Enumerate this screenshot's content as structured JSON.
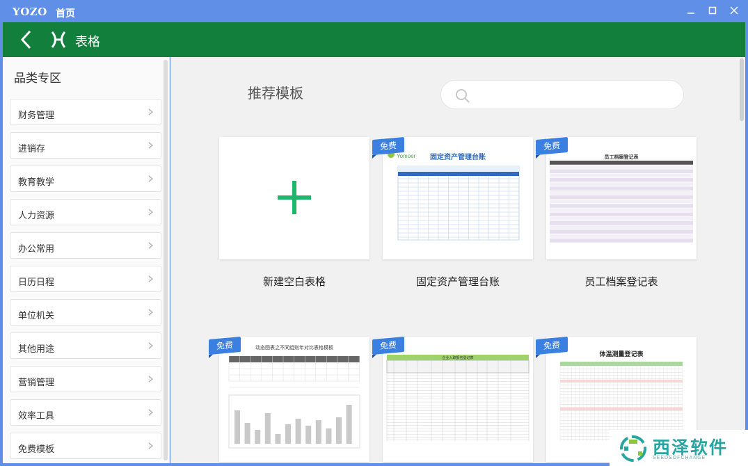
{
  "window": {
    "logo": "YOZO",
    "home_label": "首页",
    "controls": [
      "minimize-icon",
      "maximize-icon",
      "close-icon"
    ]
  },
  "appbar": {
    "title": "表格",
    "back_icon": "chevron-left-icon",
    "app_icon": "spreadsheet-x-icon"
  },
  "sidebar": {
    "heading": "品类专区",
    "items": [
      {
        "label": "财务管理"
      },
      {
        "label": "进销存"
      },
      {
        "label": "教育教学"
      },
      {
        "label": "人力资源"
      },
      {
        "label": "办公常用"
      },
      {
        "label": "日历日程"
      },
      {
        "label": "单位机关"
      },
      {
        "label": "其他用途"
      },
      {
        "label": "营销管理"
      },
      {
        "label": "效率工具"
      },
      {
        "label": "免费模板"
      }
    ]
  },
  "main": {
    "heading": "推荐模板",
    "search": {
      "placeholder": "",
      "value": ""
    },
    "badge_label": "免费",
    "templates": [
      {
        "title": "新建空白表格",
        "free": false
      },
      {
        "title": "固定资产管理台账",
        "free": true,
        "thumb_heading": "固定资产管理台账",
        "thumb_logo": "Yomoer"
      },
      {
        "title": "员工档案登记表",
        "free": true,
        "thumb_heading": "员工档案登记表"
      },
      {
        "title": "",
        "free": true,
        "thumb_heading": "动态图表之不同组别年对比表格模板"
      },
      {
        "title": "",
        "free": true,
        "thumb_heading": "企业入职报名登记表"
      },
      {
        "title": "",
        "free": true,
        "thumb_heading": "体温测量登记表"
      }
    ]
  },
  "watermark": {
    "text": "西泽软件",
    "sub": "SEEDSOFCHANGE"
  },
  "colors": {
    "titlebar": "#5f8fe6",
    "appbar": "#127f3c",
    "badge": "#3b7fe0",
    "plus": "#1fb56a"
  }
}
